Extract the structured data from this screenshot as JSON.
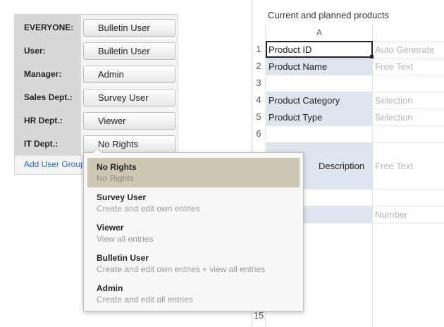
{
  "permissions": {
    "rows": [
      {
        "label": "EVERYONE:",
        "value": "Bulletin User"
      },
      {
        "label": "User:",
        "value": "Bulletin User"
      },
      {
        "label": "Manager:",
        "value": "Admin"
      },
      {
        "label": "Sales Dept.:",
        "value": "Survey User"
      },
      {
        "label": "HR Dept.:",
        "value": "Viewer"
      },
      {
        "label": "IT Dept.:",
        "value": "No Rights"
      }
    ],
    "add_group_link": "Add User Group"
  },
  "sheet": {
    "title": "Current and planned products",
    "column_header": "A",
    "row_numbers": [
      "1",
      "2",
      "3",
      "4",
      "5",
      "6",
      "15"
    ],
    "rows": [
      {
        "a": "Product ID",
        "b": "Auto Generate"
      },
      {
        "a": "Product Name",
        "b": "Free Text"
      },
      {
        "a": "",
        "b": ""
      },
      {
        "a": "Product Category",
        "b": "Selection"
      },
      {
        "a": "Product Type",
        "b": "Selection"
      },
      {
        "a": "",
        "b": ""
      },
      {
        "a": "Description",
        "b": "Free Text"
      },
      {
        "a": "",
        "b": ""
      },
      {
        "a": "",
        "b": "Number"
      }
    ]
  },
  "dropdown": {
    "items": [
      {
        "title": "No Rights",
        "desc": "No Rights"
      },
      {
        "title": "Survey User",
        "desc": "Create and edit own entries"
      },
      {
        "title": "Viewer",
        "desc": "View all entries"
      },
      {
        "title": "Bulletin User",
        "desc": "Create and edit own entries + view all entries"
      },
      {
        "title": "Admin",
        "desc": "Create and edit all entries"
      }
    ]
  },
  "colors": {
    "label_column_bg": "#d8d8d8",
    "link": "#2a6ab8",
    "cell_shade": "#dfe5ee",
    "dropdown_active": "#cdc7b3"
  }
}
